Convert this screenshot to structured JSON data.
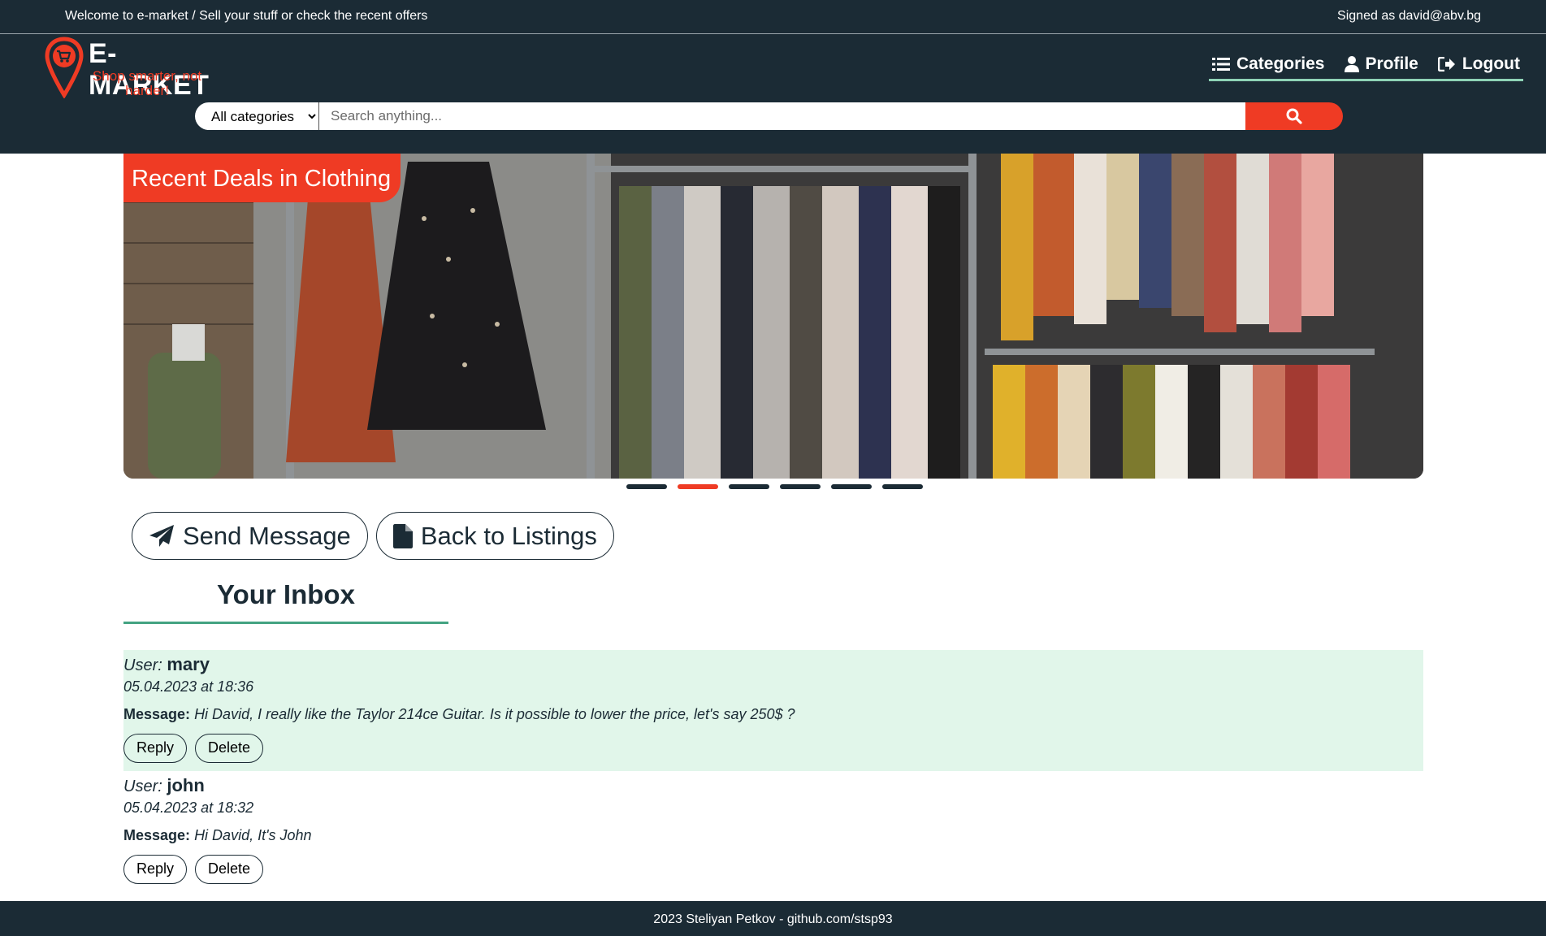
{
  "topbar": {
    "welcome": "Welcome to e-market / Sell your stuff or check the recent offers",
    "signed_as": "Signed as david@abv.bg"
  },
  "logo": {
    "title": "E-MARKET",
    "slogan": "Shop smarter, not harder!",
    "icon": "map-pin-cart-icon"
  },
  "nav": {
    "items": [
      {
        "label": "Categories",
        "icon": "list-icon"
      },
      {
        "label": "Profile",
        "icon": "user-icon"
      },
      {
        "label": "Logout",
        "icon": "logout-icon"
      }
    ]
  },
  "search": {
    "category_selected": "All categories",
    "placeholder": "Search anything...",
    "button_icon": "search-icon"
  },
  "banner": {
    "caption": "Recent Deals in Clothing",
    "slides_count": 6,
    "active_slide": 2
  },
  "actions": {
    "send_message": "Send Message",
    "back_to_listings": "Back to Listings"
  },
  "inbox": {
    "title": "Your Inbox",
    "user_prefix": "User:",
    "message_prefix": "Message:",
    "reply_label": "Reply",
    "delete_label": "Delete",
    "messages": [
      {
        "user": "mary",
        "date": "05.04.2023 at 18:36",
        "text": "Hi David, I really like the Taylor 214ce Guitar. Is it possible to lower the price, let's say 250$ ?",
        "highlighted": true
      },
      {
        "user": "john",
        "date": "05.04.2023 at 18:32",
        "text": "Hi David, It's John",
        "highlighted": false
      }
    ]
  },
  "footer": {
    "text": "2023 Steliyan Petkov - github.com/stsp93"
  },
  "colors": {
    "navy": "#1b2b35",
    "accent": "#ef3b24",
    "mint": "#8fd3b6",
    "green_line": "#43a382",
    "highlight_bg": "#e1f6ea"
  }
}
